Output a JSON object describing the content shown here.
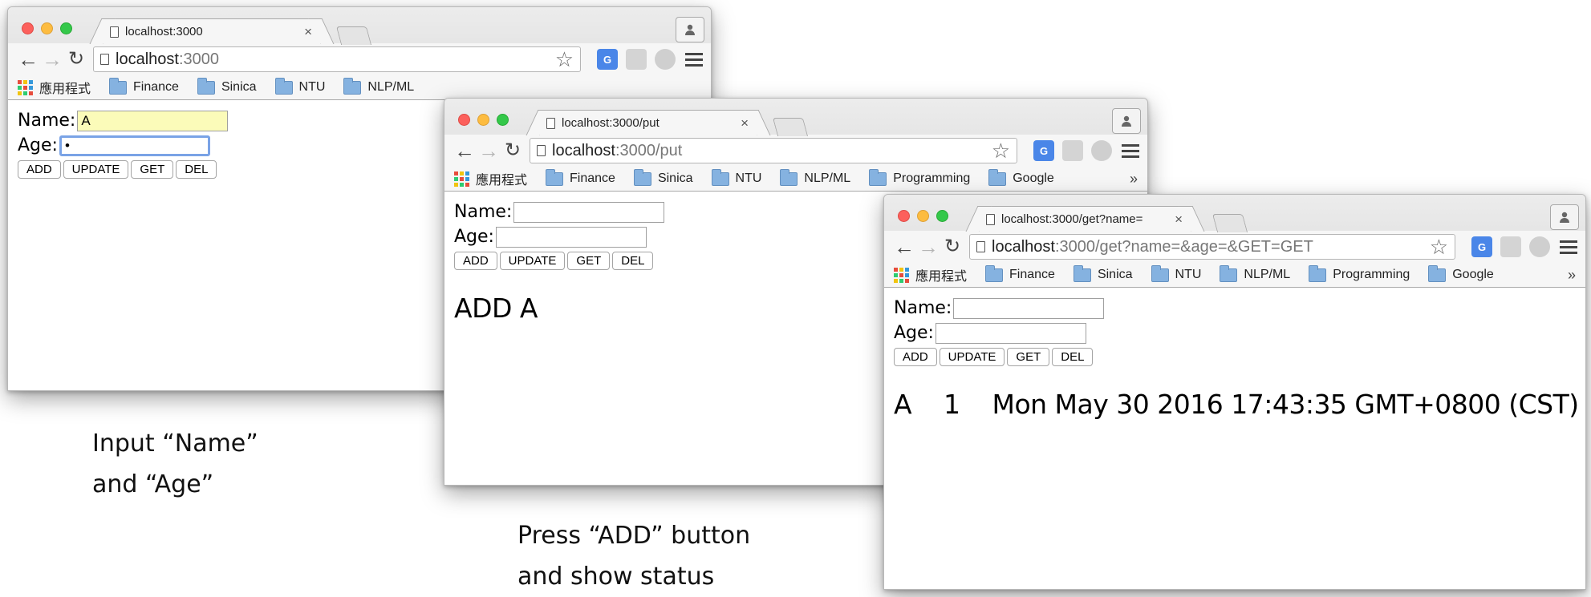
{
  "windows": [
    {
      "tab_title": "localhost:3000",
      "url_host": "localhost",
      "url_path": ":3000",
      "bookmarks": [
        "應用程式",
        "Finance",
        "Sinica",
        "NTU",
        "NLP/ML"
      ],
      "form": {
        "name_label": "Name:",
        "name_value": "A",
        "age_label": "Age:",
        "age_value": "•"
      },
      "buttons": [
        "ADD",
        "UPDATE",
        "GET",
        "DEL"
      ],
      "status": ""
    },
    {
      "tab_title": "localhost:3000/put",
      "url_host": "localhost",
      "url_path": ":3000/put",
      "bookmarks": [
        "應用程式",
        "Finance",
        "Sinica",
        "NTU",
        "NLP/ML",
        "Programming",
        "Google"
      ],
      "form": {
        "name_label": "Name:",
        "name_value": "",
        "age_label": "Age:",
        "age_value": ""
      },
      "buttons": [
        "ADD",
        "UPDATE",
        "GET",
        "DEL"
      ],
      "status": "ADD A"
    },
    {
      "tab_title": "localhost:3000/get?name=",
      "url_host": "localhost",
      "url_path": ":3000/get?name=&age=&GET=GET",
      "bookmarks": [
        "應用程式",
        "Finance",
        "Sinica",
        "NTU",
        "NLP/ML",
        "Programming",
        "Google"
      ],
      "form": {
        "name_label": "Name:",
        "name_value": "",
        "age_label": "Age:",
        "age_value": ""
      },
      "buttons": [
        "ADD",
        "UPDATE",
        "GET",
        "DEL"
      ],
      "status": "A    1    Mon May 30 2016 17:43:35 GMT+0800 (CST)"
    }
  ],
  "bookmark_overflow": "»",
  "captions": {
    "step1_line1": "Input “Name”",
    "step1_line2": "and “Age”",
    "step2_line1": "Press “ADD” button",
    "step2_line2": "and show status"
  },
  "colors": {
    "autofill": "#fbfbb9",
    "focus_ring": "#7aa3e6",
    "folder": "#85b2e0",
    "close_light": "#fc605c",
    "minimize_light": "#fdbc40",
    "zoom_light": "#34c84a"
  },
  "icons": [
    "doc-icon",
    "back-arrow-icon",
    "forward-arrow-icon",
    "reload-icon",
    "bookmark-star-icon",
    "google-translate-icon",
    "extension-icon",
    "menu-icon",
    "profile-icon",
    "folder-icon",
    "apps-grid-icon"
  ]
}
